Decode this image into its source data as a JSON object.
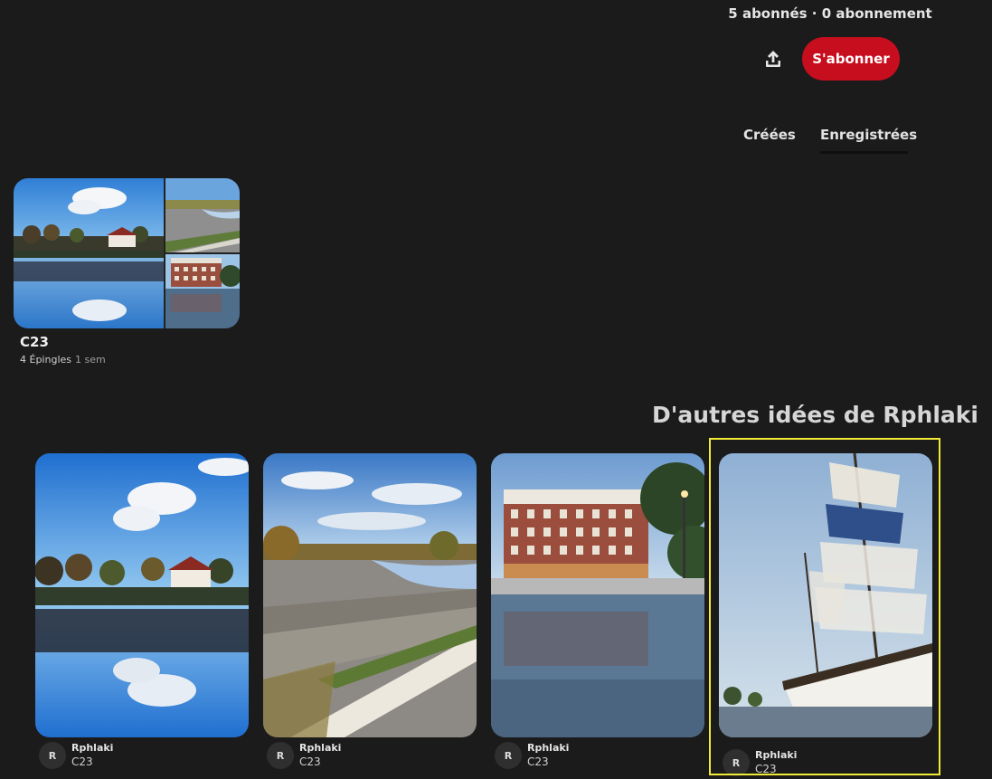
{
  "profile": {
    "stats": "5 abonnés · 0 abonnement",
    "share_icon": "upload-share-icon",
    "subscribe_label": "S'abonner",
    "subscribe_color": "#c70e1e"
  },
  "tabs": [
    {
      "label": "Créées",
      "active": false
    },
    {
      "label": "Enregistrées",
      "active": true
    }
  ],
  "board": {
    "title": "C23",
    "pins_count": "4 Épingles",
    "age": "1 sem"
  },
  "more_ideas": {
    "title": "D'autres idées de Rphlaki",
    "pins": [
      {
        "user": "Rphlaki",
        "avatar": "R",
        "board": "C23",
        "image": "river-reflection-photo"
      },
      {
        "user": "Rphlaki",
        "avatar": "R",
        "board": "C23",
        "image": "riverside-steps-photo"
      },
      {
        "user": "Rphlaki",
        "avatar": "R",
        "board": "C23",
        "image": "building-reflection-photo"
      },
      {
        "user": "Rphlaki",
        "avatar": "R",
        "board": "C23",
        "image": "tall-ship-photo"
      }
    ]
  },
  "highlight_color": "#f2ea34"
}
